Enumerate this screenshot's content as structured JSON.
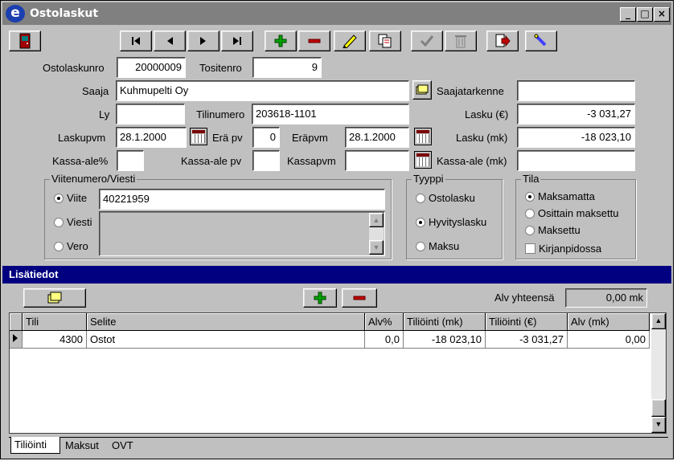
{
  "window": {
    "title": "Ostolaskut",
    "controls": {
      "minimize": "_",
      "maximize": "□",
      "close": "×"
    }
  },
  "toolbar": {
    "icons": [
      "exit-icon",
      "first-record-icon",
      "prev-record-icon",
      "next-record-icon",
      "last-record-icon",
      "add-icon",
      "delete-icon",
      "edit-icon",
      "copy-icon",
      "accept-icon",
      "trash-icon",
      "export-icon",
      "search-icon"
    ]
  },
  "form": {
    "ostolaskunro": {
      "label": "Ostolaskunro",
      "value": "20000009"
    },
    "tositenro": {
      "label": "Tositenro",
      "value": "9"
    },
    "saaja": {
      "label": "Saaja",
      "value": "Kuhmupelti Oy"
    },
    "saajatarkenne": {
      "label": "Saajatarkenne",
      "value": ""
    },
    "ly": {
      "label": "Ly",
      "value": ""
    },
    "tilinumero": {
      "label": "Tilinumero",
      "value": "203618-1101"
    },
    "lasku_eur": {
      "label": "Lasku (€)",
      "value": "-3 031,27"
    },
    "laskupvm": {
      "label": "Laskupvm",
      "value": "28.1.2000"
    },
    "era_pv": {
      "label": "Erä pv",
      "value": "0"
    },
    "erapvm": {
      "label": "Eräpvm",
      "value": "28.1.2000"
    },
    "lasku_mk": {
      "label": "Lasku (mk)",
      "value": "-18 023,10"
    },
    "kassa_ale_pct": {
      "label": "Kassa-ale%",
      "value": ""
    },
    "kassa_ale_pv": {
      "label": "Kassa-ale pv",
      "value": ""
    },
    "kassapvm": {
      "label": "Kassapvm",
      "value": ""
    },
    "kassa_ale_mk": {
      "label": "Kassa-ale (mk)",
      "value": ""
    }
  },
  "viite_group": {
    "title": "Viitenumero/Viesti",
    "options": [
      {
        "label": "Viite",
        "selected": true
      },
      {
        "label": "Viesti",
        "selected": false
      },
      {
        "label": "Vero",
        "selected": false
      }
    ],
    "viite_value": "40221959",
    "viesti_value": ""
  },
  "tyyppi_group": {
    "title": "Tyyppi",
    "options": [
      {
        "label": "Ostolasku",
        "selected": false
      },
      {
        "label": "Hyvityslasku",
        "selected": true
      },
      {
        "label": "Maksu",
        "selected": false
      }
    ]
  },
  "tila_group": {
    "title": "Tila",
    "options": [
      {
        "label": "Maksamatta",
        "selected": true
      },
      {
        "label": "Osittain maksettu",
        "selected": false
      },
      {
        "label": "Maksettu",
        "selected": false
      }
    ],
    "checkbox": {
      "label": "Kirjanpidossa",
      "checked": false
    }
  },
  "lisatiedot": {
    "title": "Lisätiedot",
    "alv_label": "Alv yhteensä",
    "alv_value": "0,00 mk"
  },
  "table": {
    "columns": [
      "Tili",
      "Selite",
      "Alv%",
      "Tiliöinti (mk)",
      "Tiliöinti (€)",
      "Alv (mk)"
    ],
    "rows": [
      [
        "4300",
        "Ostot",
        "0,0",
        "-18 023,10",
        "-3 031,27",
        "0,00"
      ]
    ]
  },
  "tabs": [
    "Tiliöinti",
    "Maksut",
    "OVT"
  ],
  "colors": {
    "title_bar": "#808080",
    "section_bar": "#000080",
    "face": "#c0c0c0",
    "add_green": "#00a000",
    "delete_red": "#c00000"
  }
}
